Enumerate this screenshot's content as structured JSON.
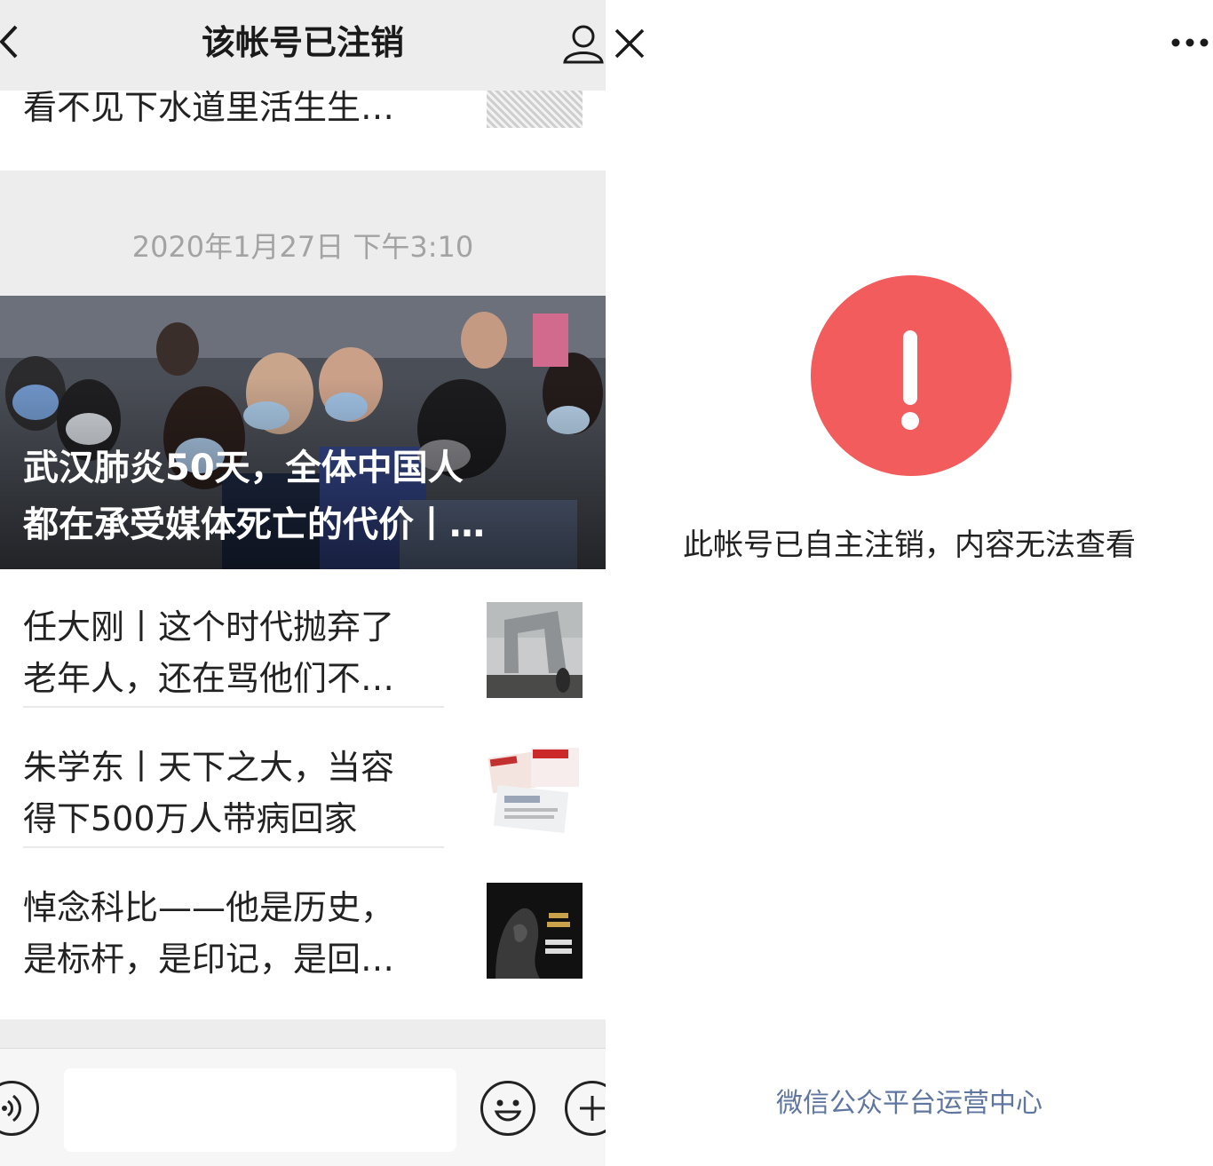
{
  "left": {
    "nav": {
      "title": "该帐号已注销"
    },
    "top_article": {
      "title": "看不见下水道里活生生…"
    },
    "timestamp": "2020年1月27日 下午3:10",
    "cover": {
      "title_line1": "武汉肺炎50天，全体中国人",
      "title_line2": "都在承受媒体死亡的代价丨…"
    },
    "articles": [
      {
        "line1": "任大刚丨这个时代抛弃了",
        "line2": "老年人，还在骂他们不…",
        "thumb": "foggy-city-photo"
      },
      {
        "line1": "朱学东丨天下之大，当容",
        "line2": "得下500万人带病回家",
        "thumb": "newspapers-photo"
      },
      {
        "line1": "悼念科比——他是历史，",
        "line2": "是标杆，是印记，是回…",
        "thumb": "kobe-book-cover"
      }
    ],
    "composer": {
      "input_placeholder": ""
    }
  },
  "right": {
    "notice": "此帐号已自主注销，内容无法查看",
    "footer_link": "微信公众平台运营中心",
    "warning_color": "#f25c5c"
  }
}
